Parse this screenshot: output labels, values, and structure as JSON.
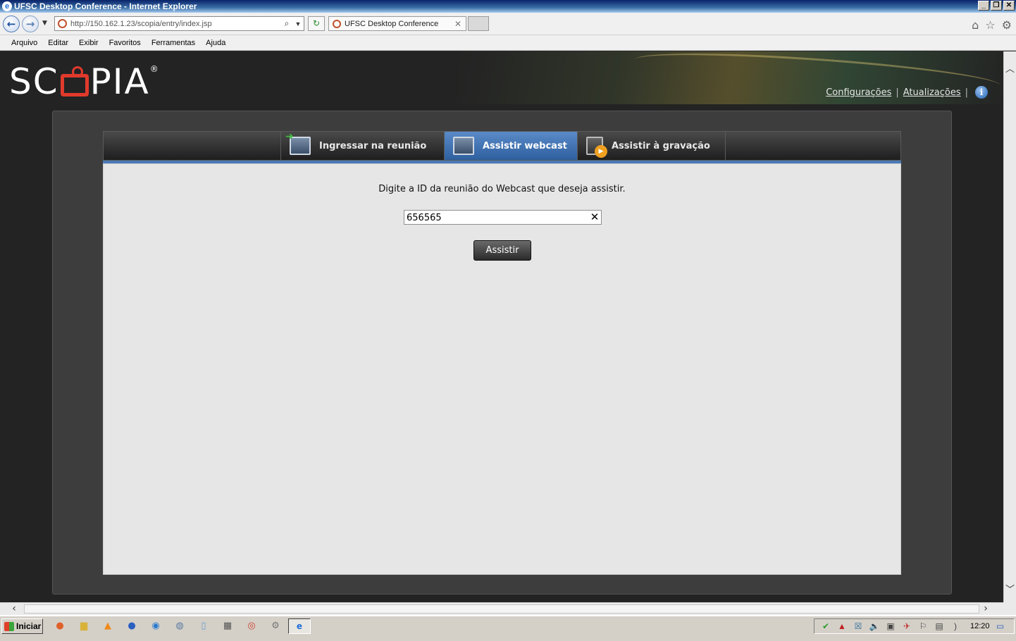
{
  "window": {
    "title": "UFSC Desktop Conference - Internet Explorer",
    "minimize": "_",
    "restore": "❐",
    "close": "✕"
  },
  "browser": {
    "url": "http://150.162.1.23/scopia/entry/index.jsp",
    "tab_title": "UFSC Desktop Conference",
    "tab_close": "✕",
    "menu": [
      "Arquivo",
      "Editar",
      "Exibir",
      "Favoritos",
      "Ferramentas",
      "Ajuda"
    ]
  },
  "page": {
    "logo_text_left": "SC",
    "logo_text_right": "PIA",
    "logo_reg": "®",
    "links": {
      "settings": "Configurações",
      "updates": "Atualizações",
      "separator": "|"
    },
    "tabs": [
      {
        "label": "Ingressar na reunião",
        "icon": "join-meeting-icon",
        "active": false
      },
      {
        "label": "Assistir webcast",
        "icon": "webcast-icon",
        "active": true
      },
      {
        "label": "Assistir à gravação",
        "icon": "recording-icon",
        "active": false
      }
    ],
    "prompt": "Digite a ID da reunião do Webcast que deseja assistir.",
    "meeting_id_value": "656565",
    "clear_glyph": "✕",
    "watch_button": "Assistir"
  },
  "taskbar": {
    "start_label": "Iniciar",
    "clock": "12:20"
  }
}
